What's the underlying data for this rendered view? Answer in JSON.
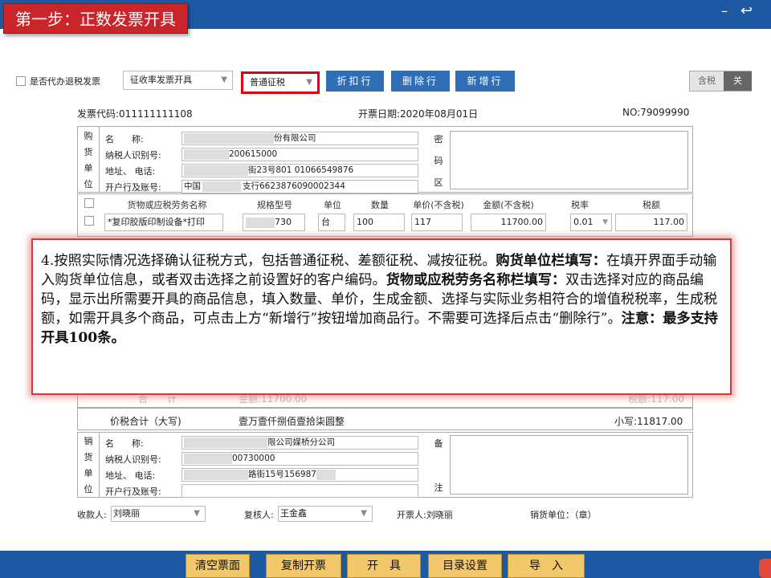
{
  "header": {
    "step_title": "第一步：正数发票开具",
    "min_icon": "minimize-icon",
    "back_icon": "back-arrow-icon"
  },
  "toolbar": {
    "agent_refund_label": "是否代办退税发票",
    "rate_select": "征收率发票开具",
    "tax_method_select": "普通征税",
    "discount_button": "折扣行",
    "delete_button": "删除行",
    "add_button": "新增行",
    "tax_included": "含税",
    "close": "关"
  },
  "invoice_meta": {
    "code": "发票代码:011111111108",
    "date": "开票日期:2020年08月01日",
    "no": "NO:79099990"
  },
  "buyer": {
    "side_label": [
      "购",
      "货",
      "单",
      "位"
    ],
    "name_label": "名　　称:",
    "name_value": "份有限公司",
    "taxid_label": "纳税人识别号:",
    "taxid_value": "200615000",
    "addr_label": "地址、 电话:",
    "addr_value": "街23号801 01066549876",
    "bank_label": "开户行及账号:",
    "bank_prefix": "中国",
    "bank_value": "支行6623876090002344",
    "cipher_label": [
      "密",
      "码",
      "区"
    ]
  },
  "goods": {
    "headers": [
      "货物或应税劳务名称",
      "规格型号",
      "单位",
      "数量",
      "单价(不含税)",
      "金额(不含税)",
      "税率",
      "税额"
    ],
    "rows": [
      {
        "name": "*复印胶版印制设备*打印",
        "spec": "730",
        "unit": "台",
        "qty": "100",
        "price": "117",
        "amount": "11700.00",
        "rate": "0.01",
        "tax": "117.00"
      }
    ]
  },
  "totals": {
    "total_label": "合　　计",
    "amount": "金额:11700.00",
    "tax": "税额:117.00",
    "price_total_label": "价税合计（大写)",
    "price_total_words": "壹万壹仟捌佰壹拾柒圆整",
    "price_total_small": "小写:11817.00"
  },
  "seller": {
    "side_label": [
      "销",
      "货",
      "单",
      "位"
    ],
    "name_label": "名　　称:",
    "name_value": "限公司媒桥分公司",
    "taxid_label": "纳税人识别号:",
    "taxid_value": "00730000",
    "addr_label": "地址、 电话:",
    "addr_value": "路街15号156987",
    "bank_label": "开户行及账号:",
    "remark_label": [
      "备",
      "注"
    ]
  },
  "signers": {
    "payee_label": "收款人:",
    "payee_value": "刘晓丽",
    "reviewer_label": "复核人:",
    "reviewer_value": "王金鑫",
    "issuer": "开票人:刘晓丽",
    "seller_stamp": "销货单位：（章）"
  },
  "popup": {
    "p1": "4.按照实际情况选择确认征税方式，包括普通征税、差额征税、减按征税。",
    "b1": "购货单位栏填写：",
    "p2": "在填开界面手动输入购货单位信息，或者双击选择之前设置好的客户编码。",
    "b2": "货物或应税劳务名称栏填写：",
    "p3": "双击选择对应的商品编码，显示出所需要开具的商品信息，填入数量、单价，生成金额、选择与实际业务相符合的增值税税率，生成税额，如需开具多个商品，可点击上方“新增行”按钮增加商品行。不需要可选择后点击“删除行”。",
    "b3": "注意：最多支持开具100条。"
  },
  "bottom_buttons": [
    "清空票面",
    "复制开票",
    "开　具",
    "目录设置",
    "导　入"
  ],
  "colors": {
    "brand_blue": "#1d5aa3",
    "step_red": "#c9252b",
    "highlight_red": "#e00010",
    "bottom_button": "#f2c86a"
  }
}
